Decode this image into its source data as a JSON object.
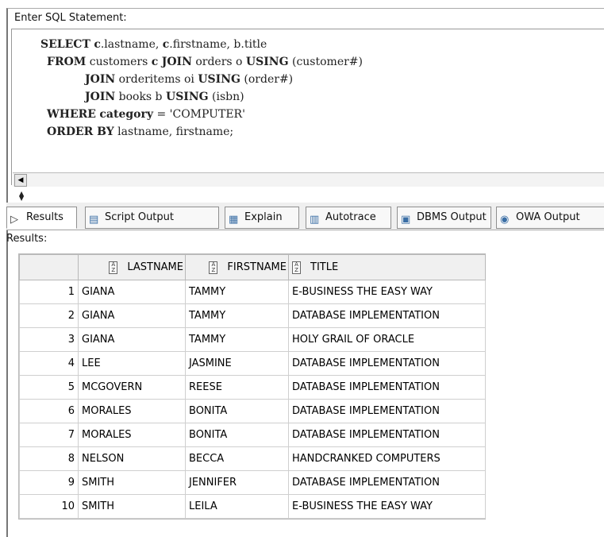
{
  "editor": {
    "label": "Enter SQL Statement:",
    "lines": [
      {
        "parts": [
          [
            "kw",
            "SELECT"
          ],
          [
            "n",
            " "
          ],
          [
            "kw",
            "c"
          ],
          [
            "n",
            ".lastname, "
          ],
          [
            "kw",
            "c"
          ],
          [
            "n",
            ".firstname, b.title"
          ]
        ],
        "indent": 0
      },
      {
        "parts": [
          [
            "kw",
            "FROM"
          ],
          [
            "n",
            " customers "
          ],
          [
            "kw",
            "c"
          ],
          [
            "n",
            " "
          ],
          [
            "kw",
            "JOIN"
          ],
          [
            "n",
            " orders o "
          ],
          [
            "kw",
            "USING"
          ],
          [
            "n",
            " (customer#)"
          ]
        ],
        "indent": 1
      },
      {
        "parts": [
          [
            "kw",
            "JOIN"
          ],
          [
            "n",
            " orderitems oi "
          ],
          [
            "kw",
            "USING"
          ],
          [
            "n",
            " (order#)"
          ]
        ],
        "indent": 7
      },
      {
        "parts": [
          [
            "kw",
            "JOIN"
          ],
          [
            "n",
            " books b "
          ],
          [
            "kw",
            "USING"
          ],
          [
            "n",
            " (isbn)"
          ]
        ],
        "indent": 7
      },
      {
        "parts": [
          [
            "kw",
            "WHERE"
          ],
          [
            "n",
            " "
          ],
          [
            "kw",
            "category"
          ],
          [
            "n",
            " = 'COMPUTER'"
          ]
        ],
        "indent": 1
      },
      {
        "parts": [
          [
            "kw",
            "ORDER BY"
          ],
          [
            "n",
            " lastname, firstname;"
          ]
        ],
        "indent": 1
      }
    ]
  },
  "tabs": [
    {
      "label": "Results",
      "icon": "results-icon"
    },
    {
      "label": "Script Output",
      "icon": "script-output-icon"
    },
    {
      "label": "Explain",
      "icon": "explain-icon"
    },
    {
      "label": "Autotrace",
      "icon": "autotrace-icon"
    },
    {
      "label": "DBMS Output",
      "icon": "dbms-output-icon"
    },
    {
      "label": "OWA Output",
      "icon": "owa-output-icon"
    }
  ],
  "results_label": "Results:",
  "columns": [
    "LASTNAME",
    "FIRSTNAME",
    "TITLE"
  ],
  "rows": [
    [
      "1",
      "GIANA",
      "TAMMY",
      "E-BUSINESS THE EASY WAY"
    ],
    [
      "2",
      "GIANA",
      "TAMMY",
      "DATABASE IMPLEMENTATION"
    ],
    [
      "3",
      "GIANA",
      "TAMMY",
      "HOLY GRAIL OF ORACLE"
    ],
    [
      "4",
      "LEE",
      "JASMINE",
      "DATABASE IMPLEMENTATION"
    ],
    [
      "5",
      "MCGOVERN",
      "REESE",
      "DATABASE IMPLEMENTATION"
    ],
    [
      "6",
      "MORALES",
      "BONITA",
      "DATABASE IMPLEMENTATION"
    ],
    [
      "7",
      "MORALES",
      "BONITA",
      "DATABASE IMPLEMENTATION"
    ],
    [
      "8",
      "NELSON",
      "BECCA",
      "HANDCRANKED COMPUTERS"
    ],
    [
      "9",
      "SMITH",
      "JENNIFER",
      "DATABASE IMPLEMENTATION"
    ],
    [
      "10",
      "SMITH",
      "LEILA",
      "E-BUSINESS THE EASY WAY"
    ]
  ]
}
